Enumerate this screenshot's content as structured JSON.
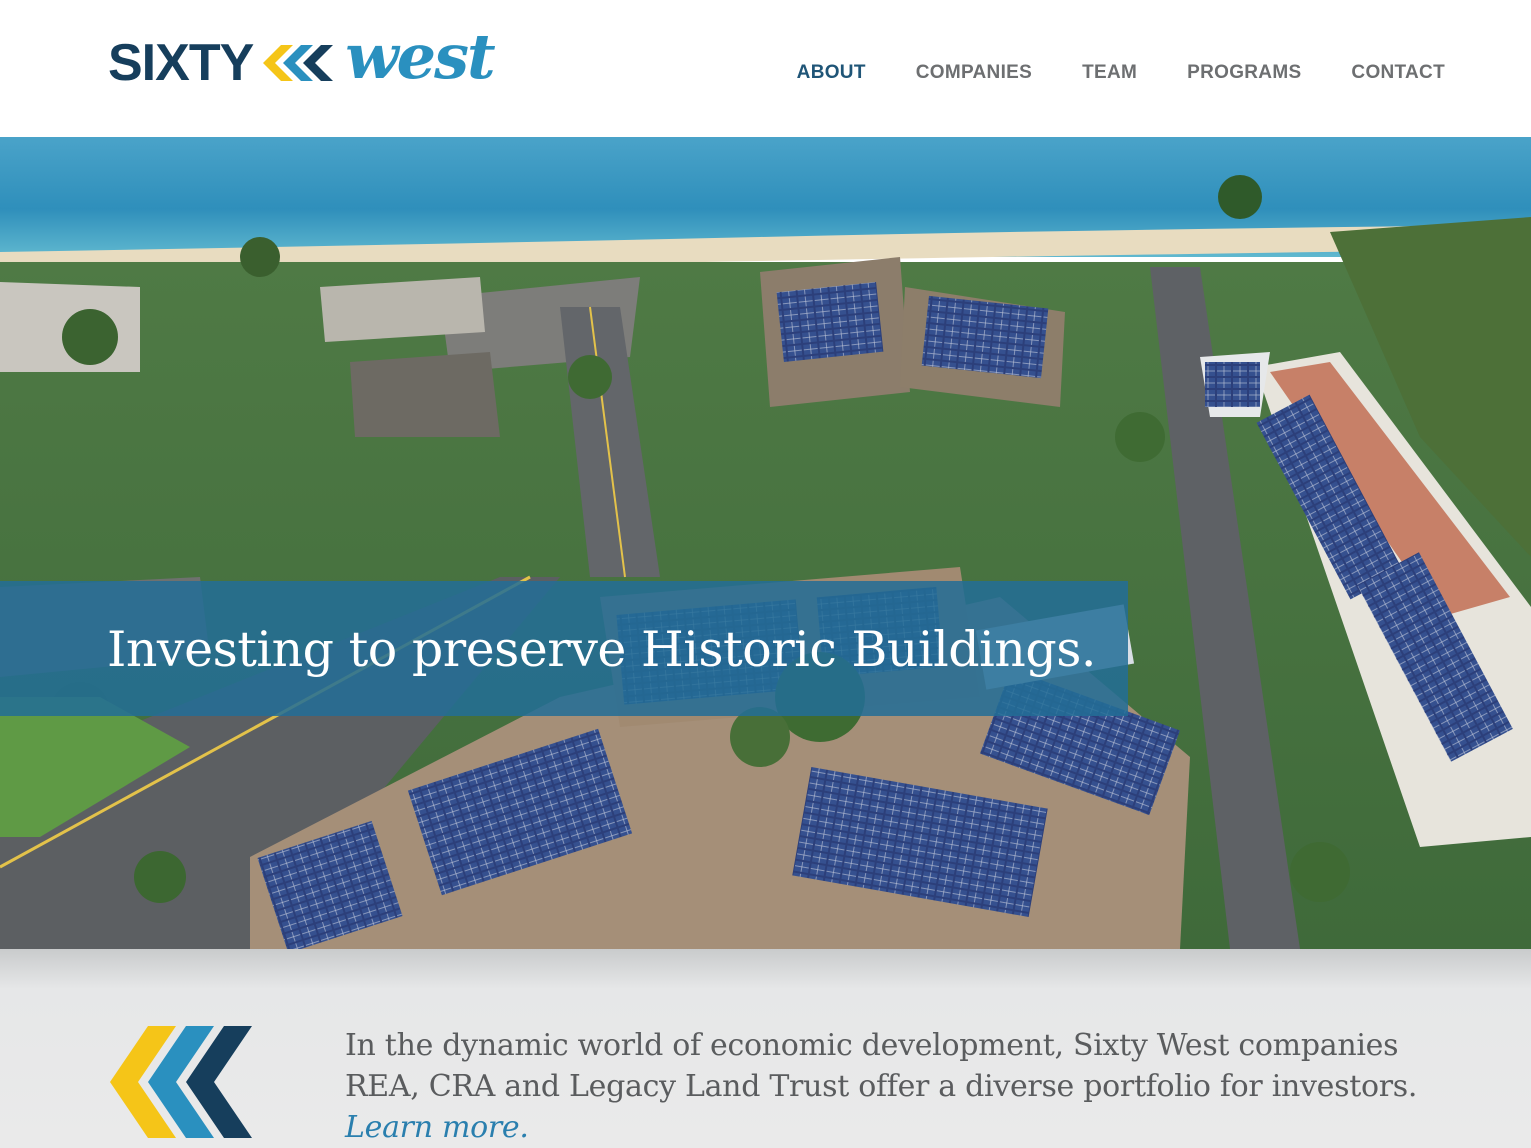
{
  "brand": {
    "word1": "SIXTY",
    "word2": "west",
    "colors": {
      "navy": "#163e5c",
      "teal": "#2a90bf",
      "yellow": "#f5c518",
      "text_gray": "#6d6f71"
    }
  },
  "nav": {
    "items": [
      {
        "label": "ABOUT",
        "active": true
      },
      {
        "label": "COMPANIES",
        "active": false
      },
      {
        "label": "TEAM",
        "active": false
      },
      {
        "label": "PROGRAMS",
        "active": false
      },
      {
        "label": "CONTACT",
        "active": false
      }
    ]
  },
  "hero": {
    "image": "aerial view of coastal resort buildings with rooftop solar panels",
    "headline": "Investing to preserve Historic Buildings."
  },
  "intro": {
    "icon": "triple-chevron-icon",
    "body": "In the dynamic world of economic development, Sixty West companies REA, CRA and Legacy Land Trust offer a diverse portfolio for investors.",
    "link_label": "Learn more."
  }
}
